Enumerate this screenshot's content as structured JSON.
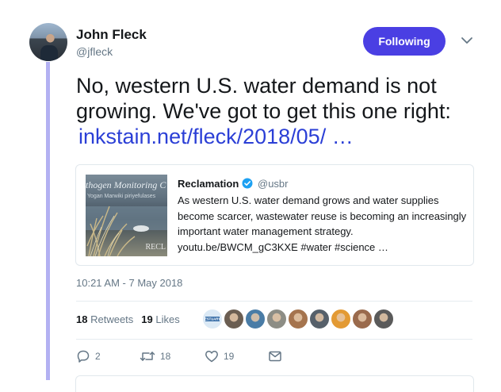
{
  "author": {
    "name": "John Fleck",
    "handle": "@jfleck"
  },
  "follow_button": {
    "label": "Following",
    "color": "#4a3fe3"
  },
  "tweet": {
    "text": "No, western U.S. water demand is not growing. We've got to get this one right:",
    "link": "inkstain.net/fleck/2018/05/ …",
    "link_color": "#2b3fd6"
  },
  "quoted": {
    "name": "Reclamation",
    "handle": "@usbr",
    "verified_icon": "verified-badge-icon",
    "text": "As western U.S. water demand grows and water supplies become scarcer, wastewater reuse is becoming an increasingly important water management strategy. youtu.be/BWCM_gC3KXE #water #science …",
    "image": {
      "text_top": "thogen Monitoring C",
      "text_sub": "Yogan Marwiki piriyefulases",
      "text_corner": "RECL"
    }
  },
  "timestamp": "10:21 AM - 7 May 2018",
  "stats": {
    "retweets_count": "18",
    "retweets_label": "Retweets",
    "likes_count": "19",
    "likes_label": "Likes"
  },
  "likers": [
    {
      "label": "ESTUARY",
      "color": "#3a6fa8"
    },
    {
      "color": "#6b5e52"
    },
    {
      "color": "#4a7ca6"
    },
    {
      "color": "#8d8d85"
    },
    {
      "color": "#a5744e"
    },
    {
      "color": "#56606a"
    },
    {
      "color": "#e39a34"
    },
    {
      "color": "#9a6a4c"
    },
    {
      "color": "#5a5a5a"
    }
  ],
  "actions": {
    "reply_count": "2",
    "retweet_count": "18",
    "like_count": "19"
  }
}
